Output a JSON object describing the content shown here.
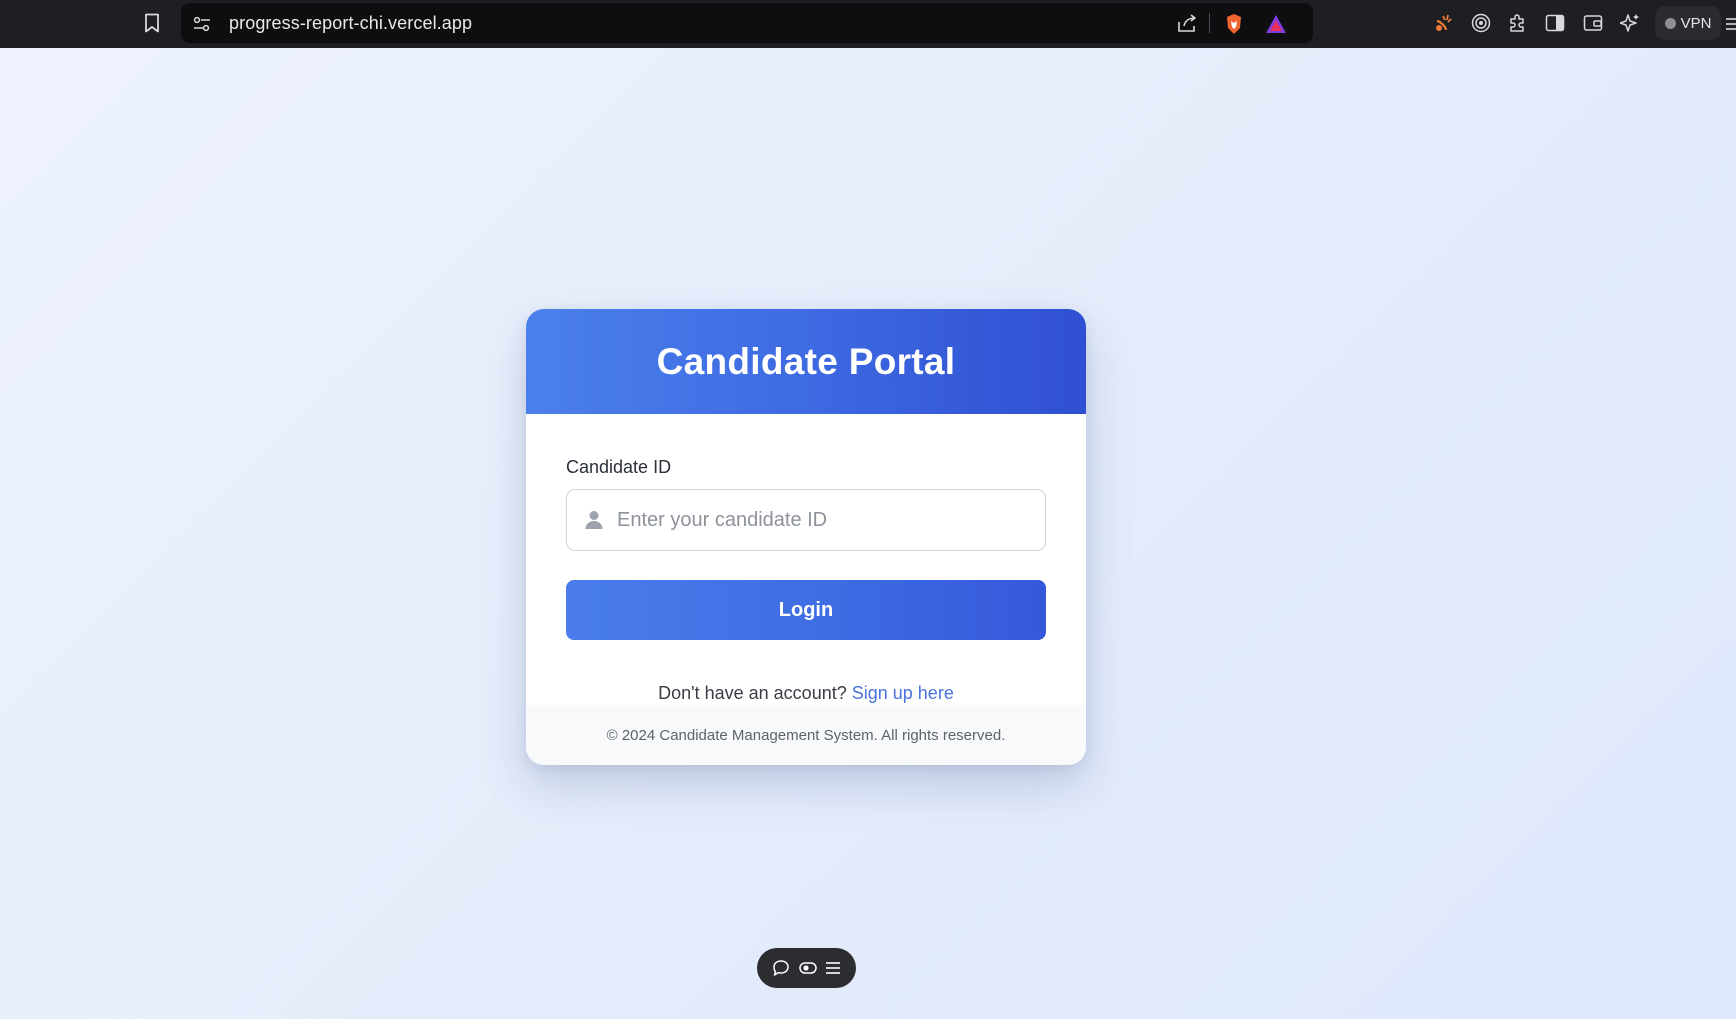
{
  "browser": {
    "url": "progress-report-chi.vercel.app",
    "vpn_label": "VPN",
    "icons": [
      "bookmark-icon",
      "site-settings-icon",
      "share-icon",
      "brave-shields-icon",
      "brave-rewards-icon",
      "brave-news-icon",
      "media-icon",
      "extensions-icon",
      "sidebar-icon",
      "wallet-icon",
      "leo-ai-icon",
      "menu-icon"
    ]
  },
  "card": {
    "title": "Candidate Portal",
    "field_label": "Candidate ID",
    "input_placeholder": "Enter your candidate ID",
    "input_value": "",
    "login_label": "Login",
    "signup_prompt": "Don't have an account?",
    "signup_link": "Sign up here",
    "footer": "© 2024 Candidate Management System. All rights reserved."
  },
  "toolbar": {
    "icons": [
      "comment-icon",
      "toggle-icon",
      "list-icon"
    ]
  },
  "colors": {
    "header_start": "#4b80ec",
    "header_end": "#2f4fd2",
    "link": "#4a73e0",
    "page_bg": "#e6edfb"
  }
}
